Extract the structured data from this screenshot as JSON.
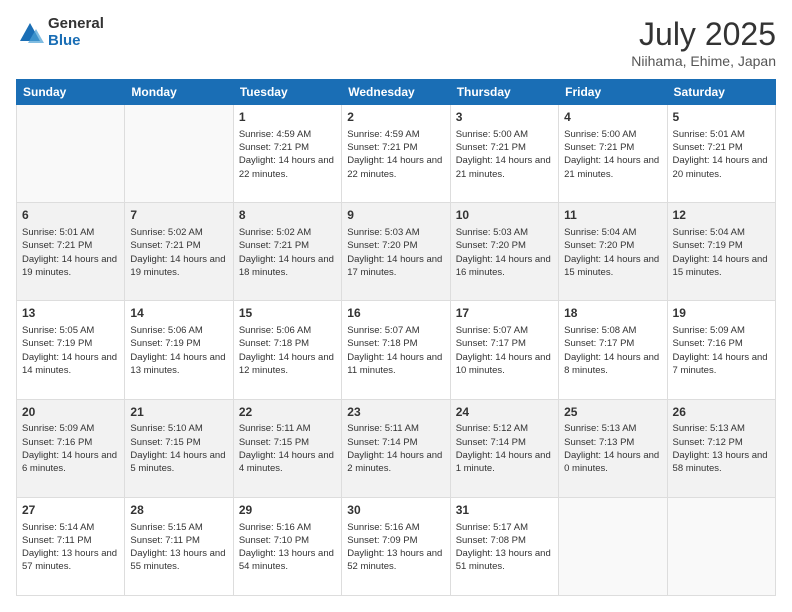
{
  "header": {
    "logo": {
      "general": "General",
      "blue": "Blue"
    },
    "title": "July 2025",
    "location": "Niihama, Ehime, Japan"
  },
  "days_of_week": [
    "Sunday",
    "Monday",
    "Tuesday",
    "Wednesday",
    "Thursday",
    "Friday",
    "Saturday"
  ],
  "weeks": [
    {
      "shade": "white",
      "days": [
        {
          "num": "",
          "sunrise": "",
          "sunset": "",
          "daylight": ""
        },
        {
          "num": "",
          "sunrise": "",
          "sunset": "",
          "daylight": ""
        },
        {
          "num": "1",
          "sunrise": "Sunrise: 4:59 AM",
          "sunset": "Sunset: 7:21 PM",
          "daylight": "Daylight: 14 hours and 22 minutes."
        },
        {
          "num": "2",
          "sunrise": "Sunrise: 4:59 AM",
          "sunset": "Sunset: 7:21 PM",
          "daylight": "Daylight: 14 hours and 22 minutes."
        },
        {
          "num": "3",
          "sunrise": "Sunrise: 5:00 AM",
          "sunset": "Sunset: 7:21 PM",
          "daylight": "Daylight: 14 hours and 21 minutes."
        },
        {
          "num": "4",
          "sunrise": "Sunrise: 5:00 AM",
          "sunset": "Sunset: 7:21 PM",
          "daylight": "Daylight: 14 hours and 21 minutes."
        },
        {
          "num": "5",
          "sunrise": "Sunrise: 5:01 AM",
          "sunset": "Sunset: 7:21 PM",
          "daylight": "Daylight: 14 hours and 20 minutes."
        }
      ]
    },
    {
      "shade": "shaded",
      "days": [
        {
          "num": "6",
          "sunrise": "Sunrise: 5:01 AM",
          "sunset": "Sunset: 7:21 PM",
          "daylight": "Daylight: 14 hours and 19 minutes."
        },
        {
          "num": "7",
          "sunrise": "Sunrise: 5:02 AM",
          "sunset": "Sunset: 7:21 PM",
          "daylight": "Daylight: 14 hours and 19 minutes."
        },
        {
          "num": "8",
          "sunrise": "Sunrise: 5:02 AM",
          "sunset": "Sunset: 7:21 PM",
          "daylight": "Daylight: 14 hours and 18 minutes."
        },
        {
          "num": "9",
          "sunrise": "Sunrise: 5:03 AM",
          "sunset": "Sunset: 7:20 PM",
          "daylight": "Daylight: 14 hours and 17 minutes."
        },
        {
          "num": "10",
          "sunrise": "Sunrise: 5:03 AM",
          "sunset": "Sunset: 7:20 PM",
          "daylight": "Daylight: 14 hours and 16 minutes."
        },
        {
          "num": "11",
          "sunrise": "Sunrise: 5:04 AM",
          "sunset": "Sunset: 7:20 PM",
          "daylight": "Daylight: 14 hours and 15 minutes."
        },
        {
          "num": "12",
          "sunrise": "Sunrise: 5:04 AM",
          "sunset": "Sunset: 7:19 PM",
          "daylight": "Daylight: 14 hours and 15 minutes."
        }
      ]
    },
    {
      "shade": "white",
      "days": [
        {
          "num": "13",
          "sunrise": "Sunrise: 5:05 AM",
          "sunset": "Sunset: 7:19 PM",
          "daylight": "Daylight: 14 hours and 14 minutes."
        },
        {
          "num": "14",
          "sunrise": "Sunrise: 5:06 AM",
          "sunset": "Sunset: 7:19 PM",
          "daylight": "Daylight: 14 hours and 13 minutes."
        },
        {
          "num": "15",
          "sunrise": "Sunrise: 5:06 AM",
          "sunset": "Sunset: 7:18 PM",
          "daylight": "Daylight: 14 hours and 12 minutes."
        },
        {
          "num": "16",
          "sunrise": "Sunrise: 5:07 AM",
          "sunset": "Sunset: 7:18 PM",
          "daylight": "Daylight: 14 hours and 11 minutes."
        },
        {
          "num": "17",
          "sunrise": "Sunrise: 5:07 AM",
          "sunset": "Sunset: 7:17 PM",
          "daylight": "Daylight: 14 hours and 10 minutes."
        },
        {
          "num": "18",
          "sunrise": "Sunrise: 5:08 AM",
          "sunset": "Sunset: 7:17 PM",
          "daylight": "Daylight: 14 hours and 8 minutes."
        },
        {
          "num": "19",
          "sunrise": "Sunrise: 5:09 AM",
          "sunset": "Sunset: 7:16 PM",
          "daylight": "Daylight: 14 hours and 7 minutes."
        }
      ]
    },
    {
      "shade": "shaded",
      "days": [
        {
          "num": "20",
          "sunrise": "Sunrise: 5:09 AM",
          "sunset": "Sunset: 7:16 PM",
          "daylight": "Daylight: 14 hours and 6 minutes."
        },
        {
          "num": "21",
          "sunrise": "Sunrise: 5:10 AM",
          "sunset": "Sunset: 7:15 PM",
          "daylight": "Daylight: 14 hours and 5 minutes."
        },
        {
          "num": "22",
          "sunrise": "Sunrise: 5:11 AM",
          "sunset": "Sunset: 7:15 PM",
          "daylight": "Daylight: 14 hours and 4 minutes."
        },
        {
          "num": "23",
          "sunrise": "Sunrise: 5:11 AM",
          "sunset": "Sunset: 7:14 PM",
          "daylight": "Daylight: 14 hours and 2 minutes."
        },
        {
          "num": "24",
          "sunrise": "Sunrise: 5:12 AM",
          "sunset": "Sunset: 7:14 PM",
          "daylight": "Daylight: 14 hours and 1 minute."
        },
        {
          "num": "25",
          "sunrise": "Sunrise: 5:13 AM",
          "sunset": "Sunset: 7:13 PM",
          "daylight": "Daylight: 14 hours and 0 minutes."
        },
        {
          "num": "26",
          "sunrise": "Sunrise: 5:13 AM",
          "sunset": "Sunset: 7:12 PM",
          "daylight": "Daylight: 13 hours and 58 minutes."
        }
      ]
    },
    {
      "shade": "white",
      "days": [
        {
          "num": "27",
          "sunrise": "Sunrise: 5:14 AM",
          "sunset": "Sunset: 7:11 PM",
          "daylight": "Daylight: 13 hours and 57 minutes."
        },
        {
          "num": "28",
          "sunrise": "Sunrise: 5:15 AM",
          "sunset": "Sunset: 7:11 PM",
          "daylight": "Daylight: 13 hours and 55 minutes."
        },
        {
          "num": "29",
          "sunrise": "Sunrise: 5:16 AM",
          "sunset": "Sunset: 7:10 PM",
          "daylight": "Daylight: 13 hours and 54 minutes."
        },
        {
          "num": "30",
          "sunrise": "Sunrise: 5:16 AM",
          "sunset": "Sunset: 7:09 PM",
          "daylight": "Daylight: 13 hours and 52 minutes."
        },
        {
          "num": "31",
          "sunrise": "Sunrise: 5:17 AM",
          "sunset": "Sunset: 7:08 PM",
          "daylight": "Daylight: 13 hours and 51 minutes."
        },
        {
          "num": "",
          "sunrise": "",
          "sunset": "",
          "daylight": ""
        },
        {
          "num": "",
          "sunrise": "",
          "sunset": "",
          "daylight": ""
        }
      ]
    }
  ]
}
